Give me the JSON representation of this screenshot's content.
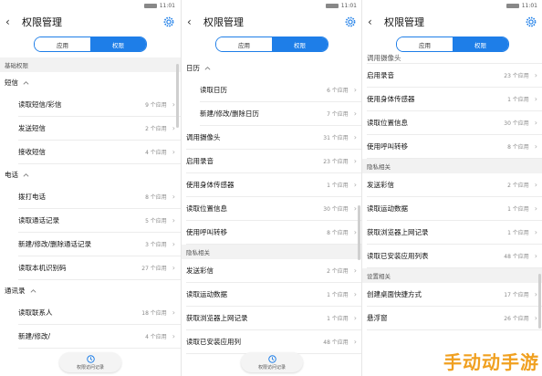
{
  "status": {
    "time": "11:01"
  },
  "header": {
    "title": "权限管理",
    "back_icon": "back-arrow-icon",
    "settings_icon": "gear-icon"
  },
  "tabs": [
    {
      "label": "应用"
    },
    {
      "label": "权限",
      "active": true
    }
  ],
  "fab": {
    "label": "权限访问记录",
    "icon": "clock-icon"
  },
  "panel1": {
    "section_basic": "基础权限",
    "group_sms": "短信",
    "sms_items": [
      {
        "label": "读取短信/彩信",
        "count": "9 个应用"
      },
      {
        "label": "发送短信",
        "count": "2 个应用"
      },
      {
        "label": "接收短信",
        "count": "4 个应用"
      }
    ],
    "group_phone": "电话",
    "phone_items": [
      {
        "label": "拨打电话",
        "count": "8 个应用"
      },
      {
        "label": "读取通话记录",
        "count": "5 个应用"
      },
      {
        "label": "新建/修改/删除通话记录",
        "count": "3 个应用"
      },
      {
        "label": "读取本机识别码",
        "count": "27 个应用"
      }
    ],
    "group_contacts": "通讯录",
    "contacts_items": [
      {
        "label": "读取联系人",
        "count": "18 个应用"
      },
      {
        "label": "新建/修改/",
        "count": "4 个应用"
      }
    ]
  },
  "panel2": {
    "group_calendar": "日历",
    "calendar_items": [
      {
        "label": "读取日历",
        "count": "6 个应用"
      },
      {
        "label": "新建/修改/删除日历",
        "count": "7 个应用"
      }
    ],
    "items": [
      {
        "label": "调用摄像头",
        "count": "31 个应用"
      },
      {
        "label": "启用录音",
        "count": "23 个应用"
      },
      {
        "label": "使用身体传感器",
        "count": "1 个应用"
      },
      {
        "label": "读取位置信息",
        "count": "30 个应用"
      },
      {
        "label": "使用呼叫转移",
        "count": "8 个应用"
      }
    ],
    "section_privacy": "隐私相关",
    "privacy_items": [
      {
        "label": "发送彩信",
        "count": "2 个应用"
      },
      {
        "label": "读取运动数据",
        "count": "1 个应用"
      },
      {
        "label": "获取浏览器上网记录",
        "count": "1 个应用"
      },
      {
        "label": "读取已安装应用列",
        "count": "48 个应用"
      }
    ]
  },
  "panel3": {
    "partial_top": "调用摄像头",
    "items": [
      {
        "label": "启用录音",
        "count": "23 个应用"
      },
      {
        "label": "使用身体传感器",
        "count": "1 个应用"
      },
      {
        "label": "读取位置信息",
        "count": "30 个应用"
      },
      {
        "label": "使用呼叫转移",
        "count": "8 个应用"
      }
    ],
    "section_privacy": "隐私相关",
    "privacy_items": [
      {
        "label": "发送彩信",
        "count": "2 个应用"
      },
      {
        "label": "读取运动数据",
        "count": "1 个应用"
      },
      {
        "label": "获取浏览器上网记录",
        "count": "1 个应用"
      },
      {
        "label": "读取已安装应用列表",
        "count": "48 个应用"
      }
    ],
    "section_settings": "设置相关",
    "settings_items": [
      {
        "label": "创建桌面快捷方式",
        "count": "17 个应用"
      },
      {
        "label": "悬浮窗",
        "count": "26 个应用"
      }
    ]
  },
  "watermark": "手动动手游"
}
